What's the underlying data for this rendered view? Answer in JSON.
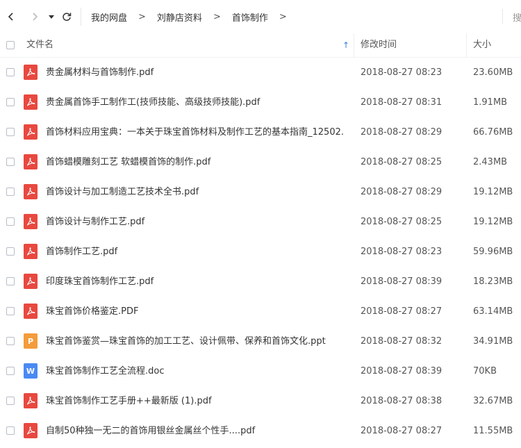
{
  "nav": {
    "breadcrumbs": [
      "我的网盘",
      "刘静店资料",
      "首饰制作"
    ],
    "separator": ">",
    "search_partial": "搜"
  },
  "header": {
    "name": "文件名",
    "modified": "修改时间",
    "size": "大小",
    "sort_arrow": "↑"
  },
  "colors": {
    "pdf": "#e8483f",
    "ppt": "#f39c3b",
    "doc": "#4a8af4",
    "accent": "#3a7ee8"
  },
  "files": [
    {
      "icon": "pdf",
      "name": "贵金属材料与首饰制作.pdf",
      "date": "2018-08-27 08:23",
      "size": "23.60MB"
    },
    {
      "icon": "pdf",
      "name": "贵金属首饰手工制作工(技师技能、高级技师技能).pdf",
      "date": "2018-08-27 08:31",
      "size": "1.91MB"
    },
    {
      "icon": "pdf",
      "name": "首饰材料应用宝典：一本关于珠宝首饰材料及制作工艺的基本指南_12502...",
      "date": "2018-08-27 08:29",
      "size": "66.76MB"
    },
    {
      "icon": "pdf",
      "name": "首饰蜡模雕刻工艺 软蜡模首饰的制作.pdf",
      "date": "2018-08-27 08:25",
      "size": "2.43MB"
    },
    {
      "icon": "pdf",
      "name": "首饰设计与加工制造工艺技术全书.pdf",
      "date": "2018-08-27 08:29",
      "size": "19.12MB"
    },
    {
      "icon": "pdf",
      "name": "首饰设计与制作工艺.pdf",
      "date": "2018-08-27 08:25",
      "size": "19.12MB"
    },
    {
      "icon": "pdf",
      "name": "首饰制作工艺.pdf",
      "date": "2018-08-27 08:23",
      "size": "59.96MB"
    },
    {
      "icon": "pdf",
      "name": "印度珠宝首饰制作工艺.pdf",
      "date": "2018-08-27 08:39",
      "size": "18.23MB"
    },
    {
      "icon": "pdf",
      "name": "珠宝首饰价格鉴定.PDF",
      "date": "2018-08-27 08:27",
      "size": "63.14MB"
    },
    {
      "icon": "ppt",
      "name": "珠宝首饰鉴赏—珠宝首饰的加工工艺、设计佩带、保养和首饰文化.ppt",
      "date": "2018-08-27 08:32",
      "size": "34.91MB"
    },
    {
      "icon": "doc",
      "name": "珠宝首饰制作工艺全流程.doc",
      "date": "2018-08-27 08:39",
      "size": "70KB"
    },
    {
      "icon": "pdf",
      "name": "珠宝首饰制作工艺手册++最新版 (1).pdf",
      "date": "2018-08-27 08:38",
      "size": "32.67MB"
    },
    {
      "icon": "pdf",
      "name": "自制50种独一无二的首饰用银丝金属丝个性手....pdf",
      "date": "2018-08-27 08:27",
      "size": "11.55MB"
    }
  ]
}
